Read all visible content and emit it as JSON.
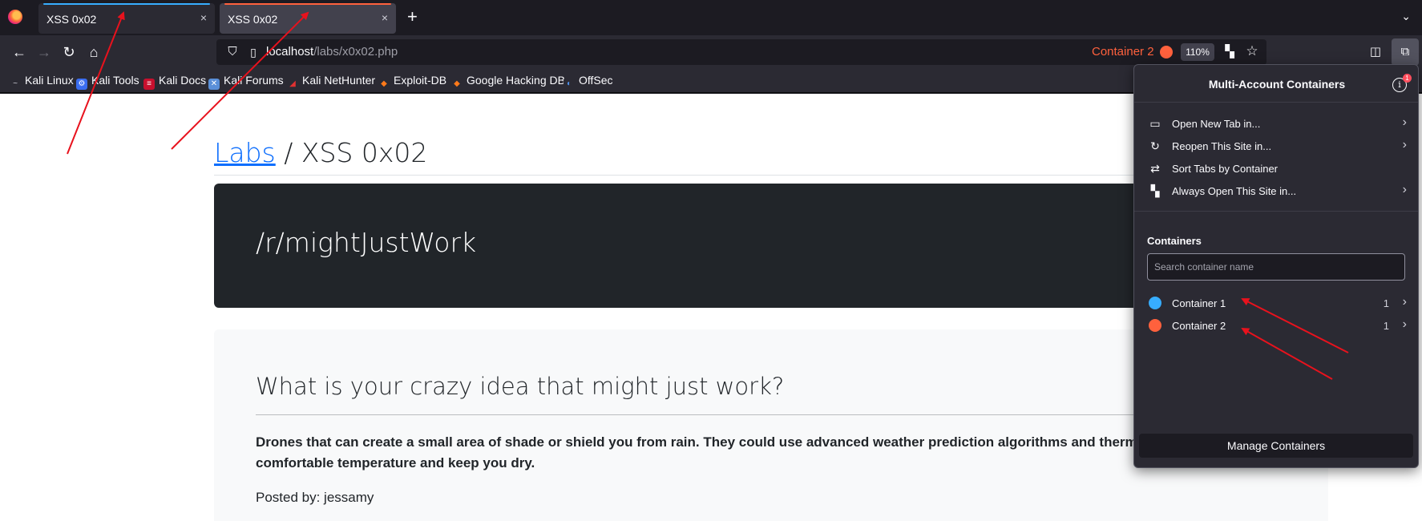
{
  "tabs": [
    {
      "title": "XSS 0x02",
      "container_color": "#37adff"
    },
    {
      "title": "XSS 0x02",
      "container_color": "#ff613d"
    }
  ],
  "tab_close_glyph": "×",
  "new_tab_glyph": "+",
  "tab_menu_glyph": "⌄",
  "address": {
    "host": "localhost",
    "path": "/labs/x0x02.php",
    "container_label": "Container 2",
    "zoom": "110%"
  },
  "bookmarks": [
    {
      "label": "Kali Linux",
      "icon": "kali-dragon-icon"
    },
    {
      "label": "Kali Tools",
      "icon": "kali-tools-icon"
    },
    {
      "label": "Kali Docs",
      "icon": "kali-docs-icon"
    },
    {
      "label": "Kali Forums",
      "icon": "kali-forums-icon"
    },
    {
      "label": "Kali NetHunter",
      "icon": "nethunter-icon"
    },
    {
      "label": "Exploit-DB",
      "icon": "exploit-db-icon"
    },
    {
      "label": "Google Hacking DB",
      "icon": "ghdb-icon"
    },
    {
      "label": "OffSec",
      "icon": "offsec-icon"
    }
  ],
  "page": {
    "breadcrumb_link": "Labs",
    "breadcrumb_sep": " / ",
    "breadcrumb_current": "XSS 0x02",
    "hero_title": "/r/mightJustWork",
    "card_title": "What is your crazy idea that might just work?",
    "card_body": "Drones that can create a small area of shade or shield you from rain. They could use advanced weather prediction algorithms and thermal c maintain a comfortable temperature and keep you dry.",
    "posted_by": "Posted by: jessamy"
  },
  "popup": {
    "title": "Multi-Account Containers",
    "badge": "1",
    "menu": [
      {
        "label": "Open New Tab in...",
        "icon": "new-tab-icon",
        "has_submenu": true
      },
      {
        "label": "Reopen This Site in...",
        "icon": "reload-icon",
        "has_submenu": true
      },
      {
        "label": "Sort Tabs by Container",
        "icon": "sort-icon",
        "has_submenu": false
      },
      {
        "label": "Always Open This Site in...",
        "icon": "always-open-icon",
        "has_submenu": true
      }
    ],
    "containers_heading": "Containers",
    "search_placeholder": "Search container name",
    "containers": [
      {
        "name": "Container 1",
        "count": "1",
        "color": "#37adff"
      },
      {
        "name": "Container 2",
        "count": "1",
        "color": "#ff613d"
      }
    ],
    "manage_label": "Manage Containers"
  },
  "annotations": {
    "arrow_color": "#e8121d"
  }
}
